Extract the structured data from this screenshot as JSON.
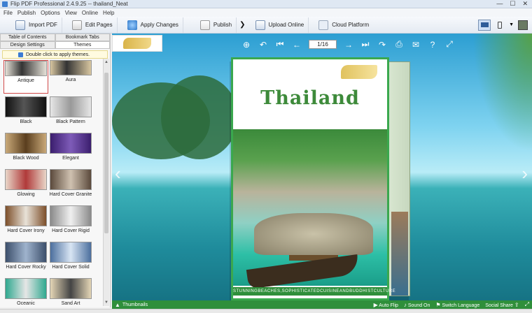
{
  "window": {
    "title": "Flip PDF Professional 2.4.9.25 -- thailand_Neat",
    "controls": [
      "—",
      "☐",
      "✕"
    ]
  },
  "menu": [
    "File",
    "Publish",
    "Options",
    "View",
    "Online",
    "Help"
  ],
  "toolbar": {
    "import_pdf": "Import PDF",
    "edit_pages": "Edit Pages",
    "apply_changes": "Apply Changes",
    "publish": "Publish",
    "upload_online": "Upload Online",
    "cloud_platform": "Cloud Platform",
    "arrow": "❯"
  },
  "left_panel": {
    "tabs_top": [
      "Table of Contents",
      "Bookmark Tabs"
    ],
    "tabs_bottom": [
      "Design Settings",
      "Themes"
    ],
    "hint": "Double click to apply themes.",
    "themes": [
      "Antique",
      "Aura",
      "Black",
      "Black Pattern",
      "Black Wood",
      "Elegant",
      "Glowing",
      "Hard Cover Granite",
      "Hard Cover Irony",
      "Hard Cover Rigid",
      "Hard Cover Rocky",
      "Hard Cover Solid",
      "Oceanic",
      "Sand Art"
    ],
    "selected_theme": "Antique"
  },
  "viewer": {
    "page_indicator": "1/16",
    "book_title": "Thailand",
    "book_tagline": "STUNNINGBEACHES,SOPHISTICATEDCUISINEANDBUDDHISTCULTURE"
  },
  "bottom_bar": {
    "thumbnails": "Thumbnails",
    "auto_flip": "Auto Flip",
    "sound_on": "Sound On",
    "switch_language": "Switch Language",
    "social_share": "Social Share"
  },
  "colors": {
    "accent_green": "#2f8f3b",
    "toolbar_blue": "#dfe8f3"
  }
}
